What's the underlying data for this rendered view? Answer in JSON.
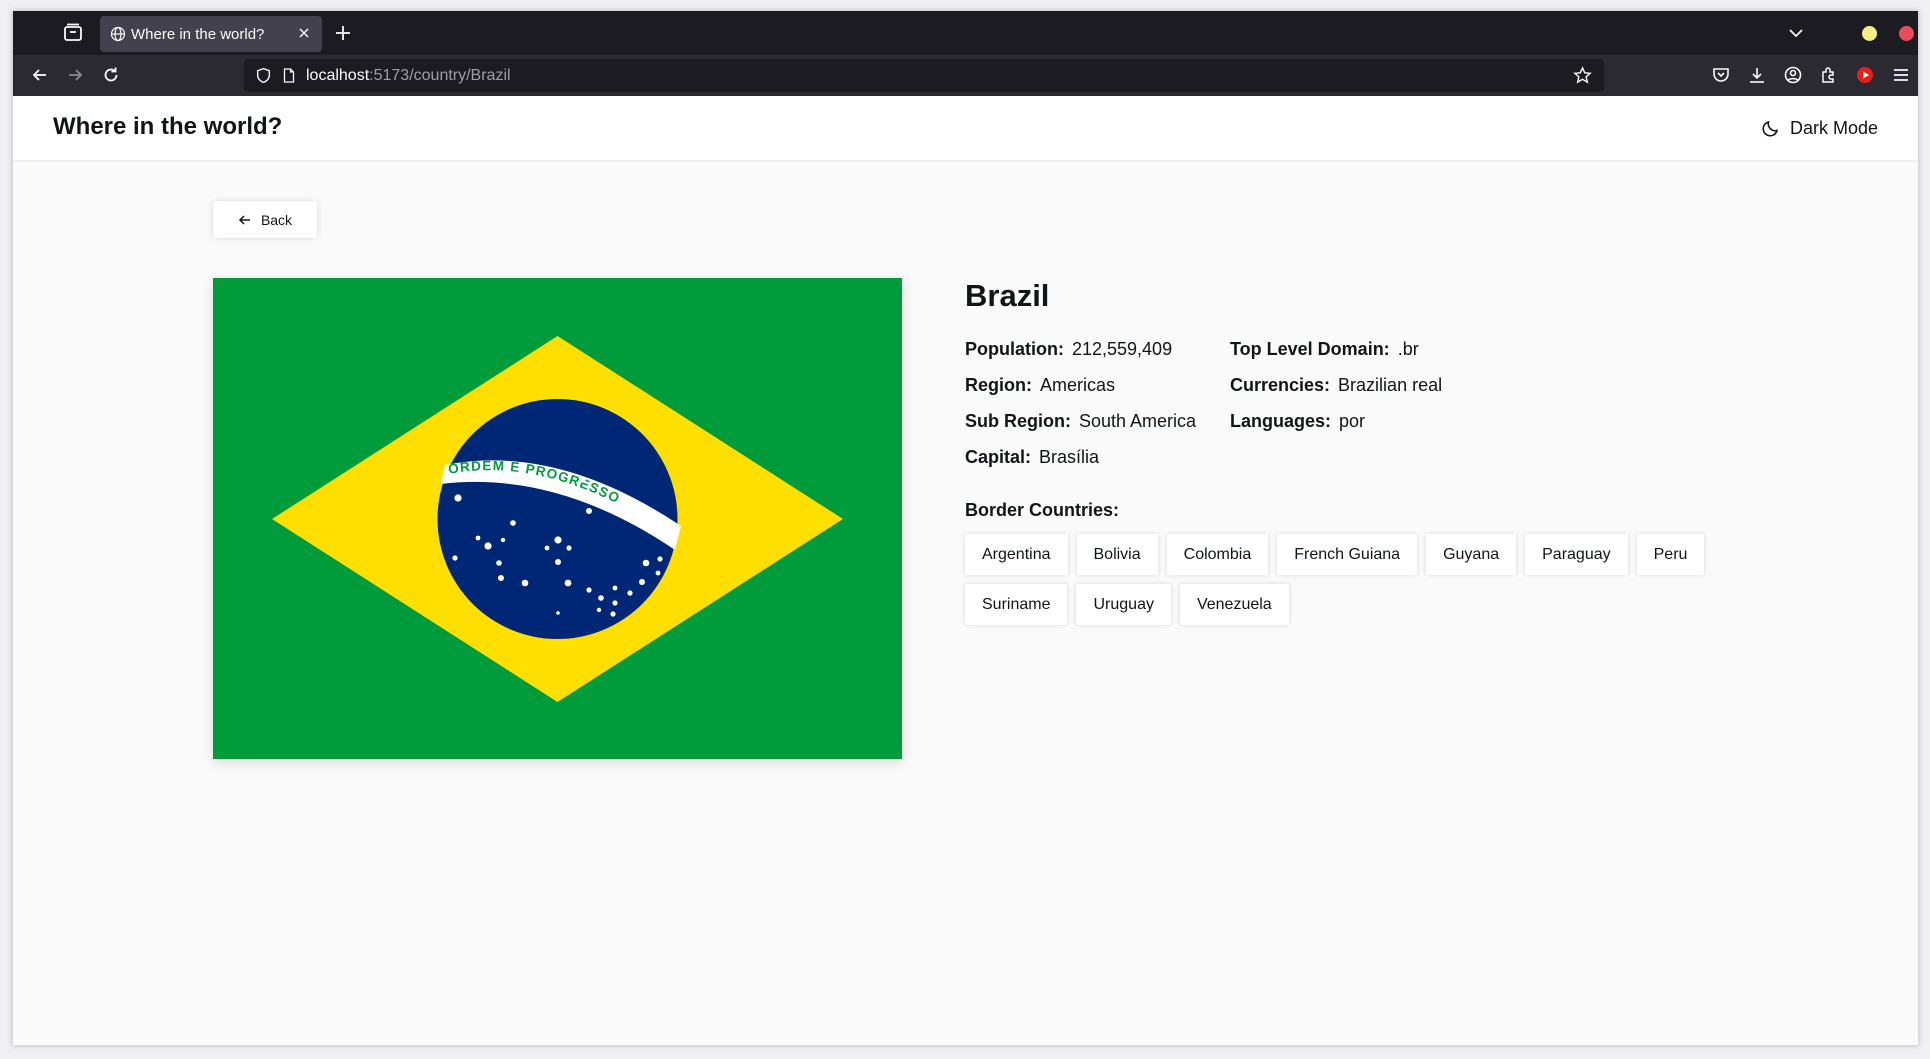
{
  "browser": {
    "tab_title": "Where in the world?",
    "url_host": "localhost",
    "url_rest": ":5173/country/Brazil"
  },
  "header": {
    "brand": "Where in the world?",
    "dark_mode_label": "Dark Mode"
  },
  "back_label": "Back",
  "country": {
    "name": "Brazil",
    "flag_motto": "ORDEM E PROGRESSO",
    "left_info": [
      {
        "label": "Population:",
        "value": "212,559,409"
      },
      {
        "label": "Region:",
        "value": "Americas"
      },
      {
        "label": "Sub Region:",
        "value": "South America"
      },
      {
        "label": "Capital:",
        "value": "Brasília"
      }
    ],
    "right_info": [
      {
        "label": "Top Level Domain:",
        "value": ".br"
      },
      {
        "label": "Currencies:",
        "value": "Brazilian real"
      },
      {
        "label": "Languages:",
        "value": "por"
      }
    ],
    "border_label": "Border Countries:",
    "borders": [
      "Argentina",
      "Bolivia",
      "Colombia",
      "French Guiana",
      "Guyana",
      "Paraguay",
      "Peru",
      "Suriname",
      "Uruguay",
      "Venezuela"
    ]
  },
  "colors": {
    "flag_green": "#009b3a",
    "flag_yellow": "#fedf00",
    "flag_blue": "#002776"
  }
}
